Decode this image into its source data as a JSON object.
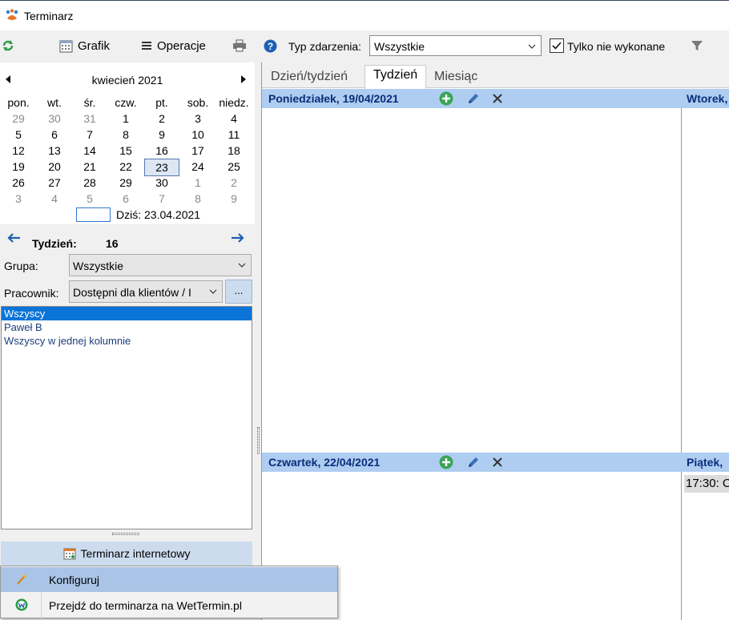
{
  "window": {
    "title": "Terminarz"
  },
  "toolbar": {
    "grafik_label": "Grafik",
    "operacje_label": "Operacje",
    "typ_label": "Typ zdarzenia:",
    "typ_value": "Wszystkie",
    "tylko_label": "Tylko nie wykonane",
    "tylko_checked": true
  },
  "calendar": {
    "month_label": "kwiecień 2021",
    "weekdays": [
      "pon.",
      "wt.",
      "śr.",
      "czw.",
      "pt.",
      "sob.",
      "niedz."
    ],
    "weeks": [
      [
        "29",
        "30",
        "31",
        "1",
        "2",
        "3",
        "4"
      ],
      [
        "5",
        "6",
        "7",
        "8",
        "9",
        "10",
        "11"
      ],
      [
        "12",
        "13",
        "14",
        "15",
        "16",
        "17",
        "18"
      ],
      [
        "19",
        "20",
        "21",
        "22",
        "23",
        "24",
        "25"
      ],
      [
        "26",
        "27",
        "28",
        "29",
        "30",
        "1",
        "2"
      ],
      [
        "3",
        "4",
        "5",
        "6",
        "7",
        "8",
        "9"
      ]
    ],
    "selected_day": "23",
    "today_label": "Dziś: 23.04.2021"
  },
  "week": {
    "label": "Tydzień:",
    "number": "16"
  },
  "filters": {
    "grupa_label": "Grupa:",
    "grupa_value": "Wszystkie",
    "pracownik_label": "Pracownik:",
    "pracownik_value": "Dostępni dla klientów / I",
    "more_label": "..."
  },
  "employees": [
    {
      "label": "Wszyscy",
      "selected": true
    },
    {
      "label": "Paweł B",
      "selected": false
    },
    {
      "label": "Wszyscy w jednej kolumnie",
      "selected": false
    }
  ],
  "online": {
    "button_label": "Terminarz internetowy"
  },
  "tabs": [
    {
      "label": "Dzień/tydzień",
      "active": false
    },
    {
      "label": "Tydzień",
      "active": true
    },
    {
      "label": "Miesiąc",
      "active": false
    }
  ],
  "days": [
    {
      "title": "Poniedziałek, 19/04/2021",
      "next_title": "Wtorek,"
    },
    {
      "title": "Czwartek, 22/04/2021",
      "next_title": "Piątek,"
    }
  ],
  "event": {
    "text": "17:30: C"
  },
  "popup": {
    "items": [
      {
        "label": "Konfiguruj",
        "highlighted": true
      },
      {
        "label": "Przejdź do terminarza na WetTermin.pl",
        "highlighted": false
      }
    ]
  },
  "colors": {
    "accent": "#0a74d8",
    "day_header": "#aecdf1",
    "day_title": "#0a2d7a",
    "menu_highlight": "#a9c4e6"
  }
}
